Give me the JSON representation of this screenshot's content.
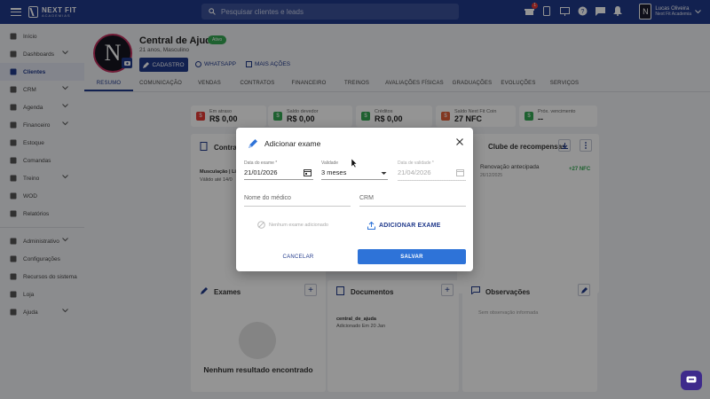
{
  "topbar": {
    "logo_line1": "NEXT FIT",
    "logo_line2": "ACADEMIAS",
    "search_placeholder": "Pesquisar clientes e leads",
    "notification_count": "1",
    "user_name": "Lucas Oliveira",
    "user_gym": "Next Fit Academia",
    "user_initial": "N"
  },
  "sidebar": {
    "items": [
      {
        "label": "Início",
        "icon": "home-icon"
      },
      {
        "label": "Dashboards",
        "icon": "chart-icon",
        "chevron": true
      },
      {
        "label": "Clientes",
        "icon": "users-icon",
        "active": true
      },
      {
        "label": "CRM",
        "icon": "handshake-icon",
        "chevron": true
      },
      {
        "label": "Agenda",
        "icon": "calendar-icon",
        "chevron": true
      },
      {
        "label": "Financeiro",
        "icon": "money-icon",
        "chevron": true
      },
      {
        "label": "Estoque",
        "icon": "cart-icon"
      },
      {
        "label": "Comandas",
        "icon": "receipt-icon"
      },
      {
        "label": "Treino",
        "icon": "dumbbell-icon",
        "chevron": true
      },
      {
        "label": "WOD",
        "icon": "kettlebell-icon"
      },
      {
        "label": "Relatórios",
        "icon": "report-icon"
      }
    ],
    "items2": [
      {
        "label": "Administrativo",
        "icon": "admin-icon",
        "chevron": true
      },
      {
        "label": "Configurações",
        "icon": "gear-icon"
      },
      {
        "label": "Recursos do sistema",
        "icon": "star-icon"
      },
      {
        "label": "Loja",
        "icon": "cart-icon"
      },
      {
        "label": "Ajuda",
        "icon": "help-icon",
        "chevron": true
      }
    ]
  },
  "profile": {
    "name": "Central de Ajuda",
    "status": "Ativo",
    "subtitle": "21 anos, Masculino",
    "cadastro": "CADASTRO",
    "whatsapp": "WHATSAPP",
    "mais_acoes": "MAIS AÇÕES"
  },
  "tabs": [
    "RESUMO",
    "COMUNICAÇÃO",
    "VENDAS",
    "CONTRATOS",
    "FINANCEIRO",
    "TREINOS",
    "AVALIAÇÕES FÍSICAS",
    "GRADUAÇÕES",
    "EVOLUÇÕES",
    "SERVIÇOS"
  ],
  "stats": [
    {
      "label": "Em atraso",
      "value": "R$ 0,00",
      "color": "#e53935"
    },
    {
      "label": "Saldo devedor",
      "value": "R$ 0,00",
      "color": "#35a853"
    },
    {
      "label": "Créditos",
      "value": "R$ 0,00",
      "color": "#35a853"
    },
    {
      "label": "Saldo Next Fit Coin",
      "value": "27 NFC",
      "color": "#e0603a"
    },
    {
      "label": "Próx. vencimento",
      "value": "--",
      "color": "#35a853"
    }
  ],
  "cards": {
    "contratos_title": "Contrat",
    "contratos_line1": "Musculação | Li",
    "contratos_line2": "Válido até 14/0",
    "clube_title": "Clube de recompensas",
    "clube_item": "Renovação antecipada",
    "clube_date": "26/12/2025",
    "clube_value": "+27 NFC",
    "exames_title": "Exames",
    "exames_empty": "Nenhum resultado encontrado",
    "docs_title": "Documentos",
    "doc_name": "central_de_ajuda",
    "doc_added": "Adicionado Em 20 Jan",
    "obs_title": "Observações",
    "obs_empty": "Sem observação informada"
  },
  "modal": {
    "title": "Adicionar exame",
    "date_label": "Data do exame *",
    "date_value": "21/01/2026",
    "validity_label": "Validade",
    "validity_value": "3 meses",
    "valid_date_label": "Data de validade *",
    "valid_date_value": "21/04/2026",
    "doctor_placeholder": "Nome do médico",
    "crm_placeholder": "CRM",
    "no_exam": "Nenhum exame adicionado",
    "add_exam": "ADICIONAR EXAME",
    "cancel": "CANCELAR",
    "save": "SALVAR"
  }
}
